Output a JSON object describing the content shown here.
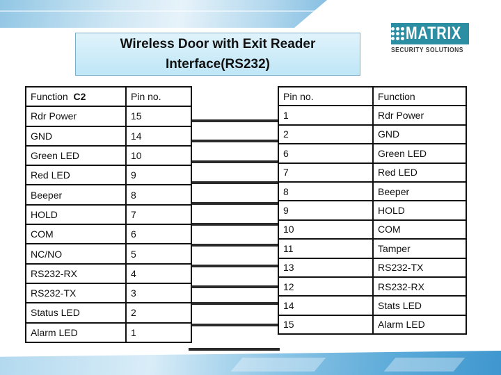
{
  "slide": {
    "title": "Wireless Door with Exit Reader\nInterface(RS232)",
    "logo": {
      "icon": "matrix-dots-icon",
      "name": "MATRIX",
      "tagline": "SECURITY SOLUTIONS",
      "brand_color": "#2b8ea2"
    }
  },
  "left_table": {
    "headers": {
      "function": "Function",
      "function_suffix": "C2",
      "pin": "Pin no."
    },
    "rows": [
      {
        "function": "Rdr Power",
        "pin": "15"
      },
      {
        "function": "GND",
        "pin": "14"
      },
      {
        "function": "Green LED",
        "pin": "10"
      },
      {
        "function": "Red LED",
        "pin": "9"
      },
      {
        "function": "Beeper",
        "pin": "8"
      },
      {
        "function": "HOLD",
        "pin": "7"
      },
      {
        "function": "COM",
        "pin": "6"
      },
      {
        "function": "NC/NO",
        "pin": "5"
      },
      {
        "function": "RS232-RX",
        "pin": "4"
      },
      {
        "function": "RS232-TX",
        "pin": "3"
      },
      {
        "function": "Status LED",
        "pin": "2"
      },
      {
        "function": "Alarm LED",
        "pin": "1"
      }
    ]
  },
  "right_table": {
    "headers": {
      "pin": "Pin no.",
      "function": "Function"
    },
    "rows": [
      {
        "pin": "1",
        "function": "Rdr Power"
      },
      {
        "pin": "2",
        "function": "GND"
      },
      {
        "pin": "6",
        "function": "Green LED"
      },
      {
        "pin": "7",
        "function": "Red LED"
      },
      {
        "pin": "8",
        "function": "Beeper"
      },
      {
        "pin": "9",
        "function": "HOLD"
      },
      {
        "pin": "10",
        "function": "COM"
      },
      {
        "pin": "11",
        "function": "Tamper"
      },
      {
        "pin": "13",
        "function": "RS232-TX"
      },
      {
        "pin": "12",
        "function": "RS232-RX"
      },
      {
        "pin": "14",
        "function": "Stats LED"
      },
      {
        "pin": "15",
        "function": "Alarm LED"
      }
    ]
  },
  "wires": {
    "count": 12,
    "color": "#2a2a2a"
  }
}
